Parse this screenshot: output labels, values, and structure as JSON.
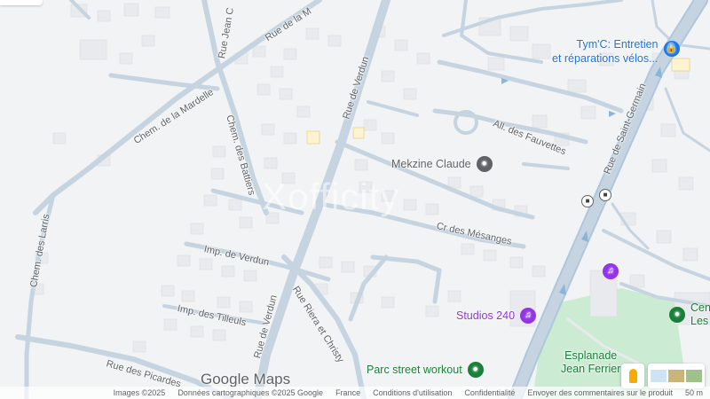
{
  "streets": {
    "rue_de_la_mardelle": "Rue de la M",
    "rue_jean": "Rue Jean C",
    "chem_mardelle": "Chem. de la Mardelle",
    "chem_battiers": "Chem. des Battiers",
    "rue_de_verdun_top": "Rue de Verdun",
    "rue_de_verdun_bottom": "Rue de Verdun",
    "all_fauvettes": "All. des Fauvettes",
    "rue_saint_germain": "Rue de Saint-Germain",
    "cr_mesanges": "Cr des Mésanges",
    "imp_verdun": "Imp. de Verdun",
    "imp_tilleuls": "Imp. des Tilleuls",
    "rue_riera": "Rue Riera et Christy",
    "chem_larris": "Chem. des Larris",
    "rue_picardes": "Rue des Picardes"
  },
  "places": {
    "tymc_line1": "Tym'C: Entretien",
    "tymc_line2": "et réparations vélos...",
    "mekzine": "Mekzine Claude",
    "studios": "Studios 240",
    "parc": "Parc street workout",
    "esplanade_line1": "Esplanade",
    "esplanade_line2": "Jean Ferrier",
    "centre_line1": "Cen",
    "centre_line2": "Les"
  },
  "watermark": "Xofficity",
  "logo": "Google Maps",
  "footer": {
    "images": "Images ©2025",
    "data": "Données cartographiques ©2025 Google",
    "country": "France",
    "terms": "Conditions d'utilisation",
    "privacy": "Confidentialité",
    "feedback": "Envoyer des commentaires sur le produit",
    "scale": "50 m"
  },
  "icons": {
    "tymc": "lock-bag-icon",
    "mekzine": "place-pin-icon",
    "studios": "entertainment-icon",
    "parc": "park-pin-icon",
    "centre": "park-pin-icon",
    "bus": "bus-stop-icon",
    "pegman": "street-view-icon",
    "layers": "layers-icon"
  },
  "colors": {
    "background": "#f1f3f4",
    "roads": "#c5d4e0",
    "buildings": "#e8eaed",
    "park": "#ccebd3",
    "blue_poi": "#1a73e8",
    "purple_poi": "#9334e6",
    "green_poi": "#188038",
    "grey_poi": "#5f6368"
  }
}
